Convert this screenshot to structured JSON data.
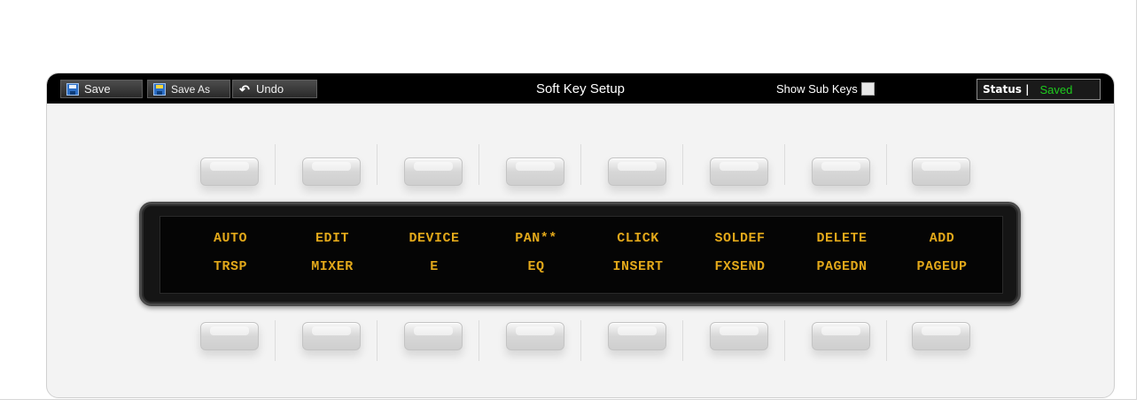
{
  "toolbar": {
    "save_label": "Save",
    "save_as_label": "Save As",
    "undo_label": "Undo",
    "title": "Soft Key Setup",
    "show_sub_keys_label": "Show Sub Keys",
    "show_sub_keys_checked": false,
    "status_label": "Status |",
    "status_value": "Saved",
    "status_color": "#1ecb1e"
  },
  "display": {
    "top_row": [
      "AUTO",
      "EDIT",
      "DEVICE",
      "PAN**",
      "CLICK",
      "SOLDEF",
      "DELETE",
      "ADD"
    ],
    "bottom_row": [
      "TRSP",
      "MIXER",
      "E",
      "EQ",
      "INSERT",
      "FXSEND",
      "PAGEDN",
      "PAGEUP"
    ],
    "text_color": "#e2a81a"
  },
  "icons": {
    "save": "floppy-disk-icon",
    "save_as": "floppy-disk-edit-icon",
    "undo": "undo-arrow-icon"
  }
}
